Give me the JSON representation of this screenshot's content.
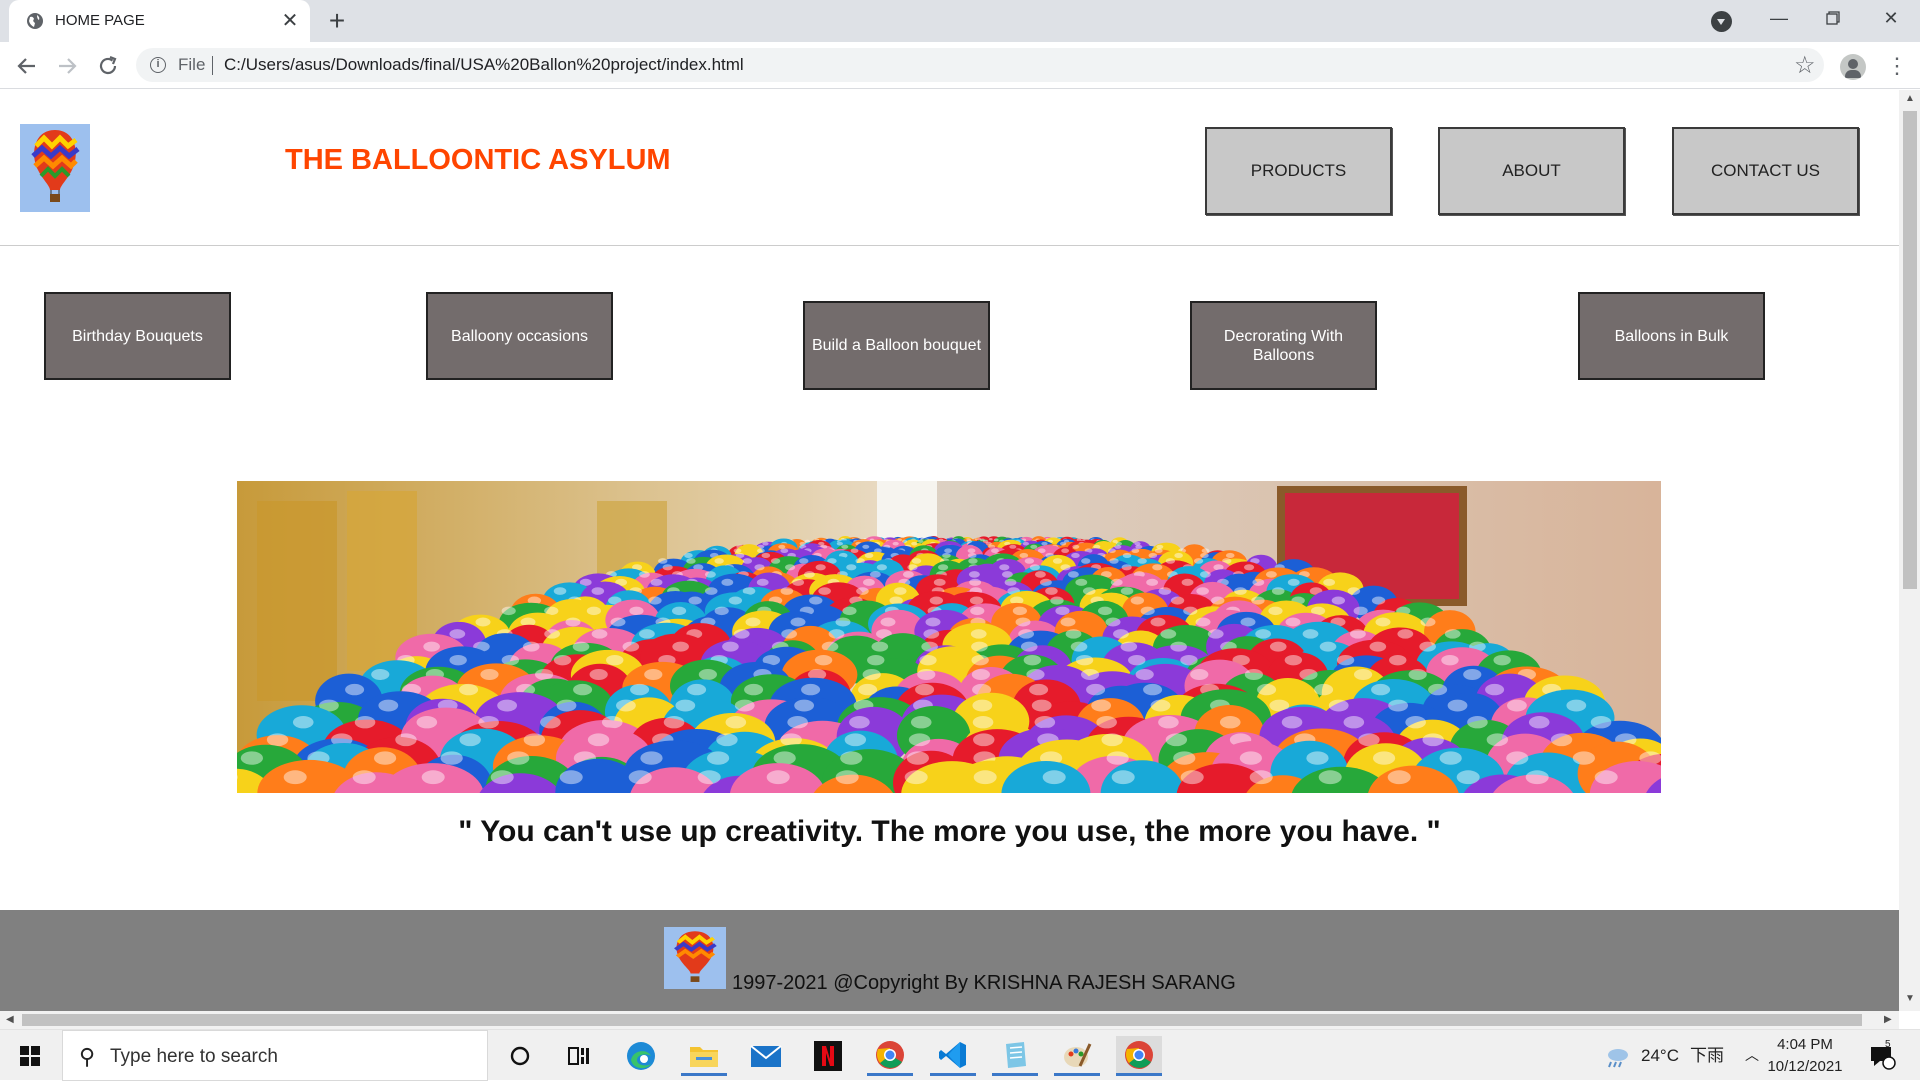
{
  "browser": {
    "tab_title": "HOME PAGE",
    "tab_close": "✕",
    "new_tab": "+",
    "address_scheme": "File",
    "address_url": "C:/Users/asus/Downloads/final/USA%20Ballon%20project/index.html"
  },
  "site": {
    "title": "THE BALLOONTIC ASYLUM",
    "nav": [
      "PRODUCTS",
      "ABOUT",
      "CONTACT US"
    ],
    "categories": [
      {
        "label": "Birthday Bouquets"
      },
      {
        "label": "Balloony occasions"
      },
      {
        "label": "Build a Balloon bouquet"
      },
      {
        "label": "Decrorating With Balloons"
      },
      {
        "label": "Balloons in Bulk"
      }
    ],
    "quote": "\" You can't use up creativity. The more you use, the more you have. \"",
    "copyright": "1997-2021 @Copyright By KRISHNA RAJESH SARANG",
    "colors": {
      "title": "#ff4500",
      "category_bg": "#736c6c",
      "nav_bg": "#c8c8c8",
      "footer_bg": "#808080"
    }
  },
  "taskbar": {
    "search_placeholder": "Type here to search",
    "weather_temp": "24°C",
    "weather_desc": "下雨",
    "time": "4:04 PM",
    "date": "10/12/2021",
    "notification_count": "5",
    "apps": [
      "cortana-icon",
      "task-view-icon",
      "edge-icon",
      "file-explorer-icon",
      "mail-icon",
      "netflix-icon",
      "chrome-icon",
      "vscode-icon",
      "notepad-icon",
      "paint-icon",
      "chrome-active-icon"
    ]
  }
}
